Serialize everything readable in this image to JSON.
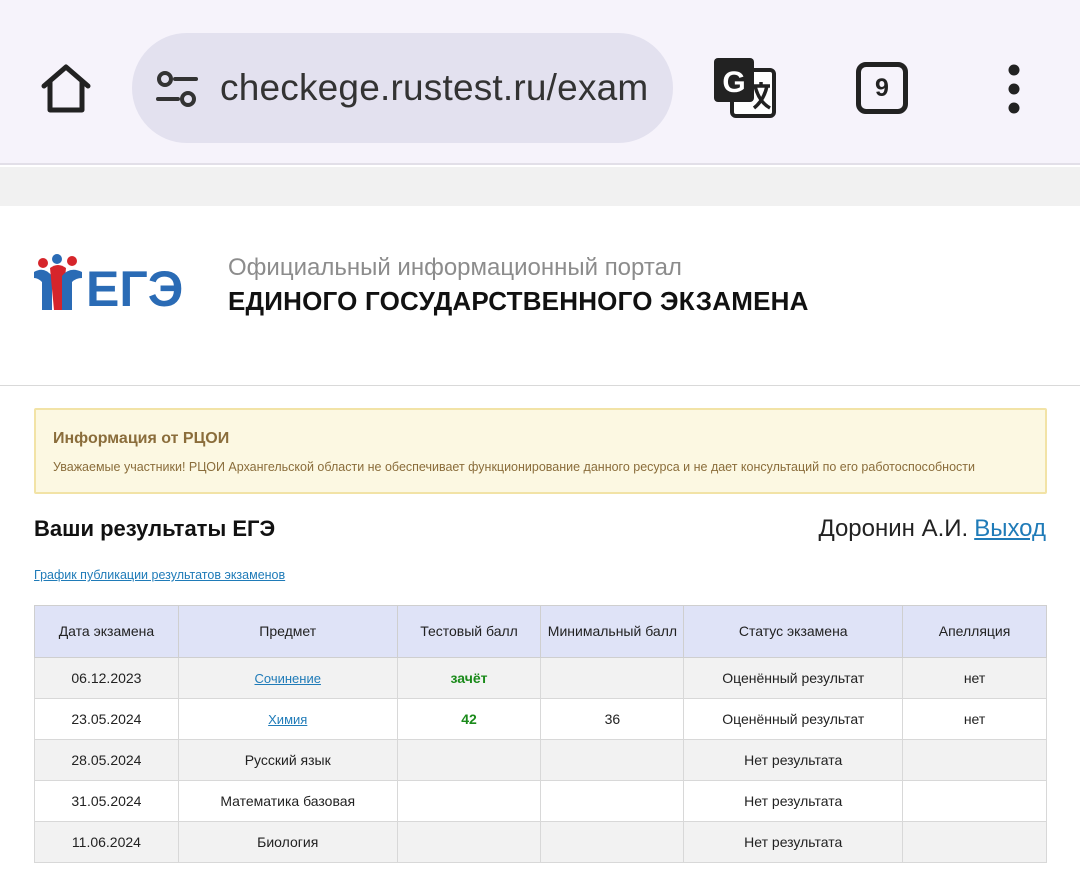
{
  "browser": {
    "url": "checkege.rustest.ru/exam",
    "tab_count": "9",
    "icons": {
      "home": "home-icon",
      "site_settings": "tune-icon",
      "translate": "translate-icon",
      "tabs": "tabs-icon",
      "menu": "more-vert-icon"
    }
  },
  "header": {
    "logo_text": "ЕГЭ",
    "line1": "Официальный информационный портал",
    "line2": "ЕДИНОГО ГОСУДАРСТВЕННОГО ЭКЗАМЕНА"
  },
  "info": {
    "title": "Информация от РЦОИ",
    "text": "Уважаемые участники! РЦОИ Архангельской области не обеспечивает функционирование данного ресурса и не дает консультаций по его работоспособности"
  },
  "results": {
    "title": "Ваши результаты ЕГЭ",
    "user_name": "Доронин А.И.",
    "logout_label": "Выход",
    "schedule_link": "График публикации результатов экзаменов"
  },
  "table": {
    "headers": {
      "date": "Дата экзамена",
      "subject": "Предмет",
      "test_score": "Тестовый балл",
      "min_score": "Минимальный балл",
      "status": "Статус экзамена",
      "appeal": "Апелляция"
    },
    "rows": [
      {
        "date": "06.12.2023",
        "subject": "Сочинение",
        "test_score": "зачёт",
        "min_score": "",
        "status": "Оценённый результат",
        "appeal": "нет"
      },
      {
        "date": "23.05.2024",
        "subject": "Химия",
        "test_score": "42",
        "min_score": "36",
        "status": "Оценённый результат",
        "appeal": "нет"
      },
      {
        "date": "28.05.2024",
        "subject": "Русский язык",
        "test_score": "",
        "min_score": "",
        "status": "Нет результата",
        "appeal": ""
      },
      {
        "date": "31.05.2024",
        "subject": "Математика базовая",
        "test_score": "",
        "min_score": "",
        "status": "Нет результата",
        "appeal": ""
      },
      {
        "date": "11.06.2024",
        "subject": "Биология",
        "test_score": "",
        "min_score": "",
        "status": "Нет результата",
        "appeal": ""
      }
    ]
  },
  "colors": {
    "link": "#1f7bb8",
    "score_green": "#1a8a1a",
    "info_text": "#8a6d3b",
    "table_header_bg": "#dfe3f7"
  }
}
